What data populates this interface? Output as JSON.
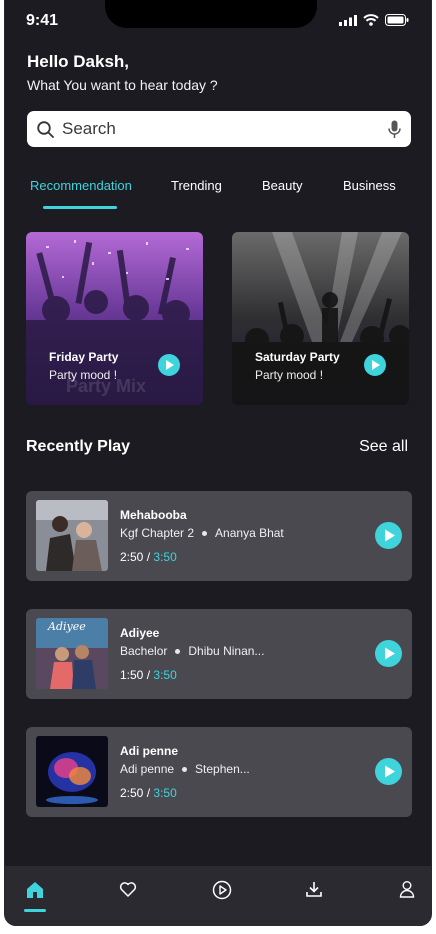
{
  "statusbar": {
    "time": "9:41"
  },
  "header": {
    "greeting": "Hello Daksh,",
    "subtitle": "What You want to hear today ?"
  },
  "search": {
    "placeholder": "Search"
  },
  "tabs": [
    {
      "label": "Recommendation",
      "active": true
    },
    {
      "label": "Trending",
      "active": false
    },
    {
      "label": "Beauty",
      "active": false
    },
    {
      "label": "Business",
      "active": false
    }
  ],
  "featured": [
    {
      "title": "Friday Party",
      "subtitle": "Party mood !",
      "watermark": "Party Mix"
    },
    {
      "title": "Saturday Party",
      "subtitle": "Party mood !"
    }
  ],
  "recent": {
    "title": "Recently Play",
    "see_all": "See all",
    "songs": [
      {
        "title": "Mehabooba",
        "album": "Kgf Chapter 2",
        "artist": "Ananya Bhat",
        "elapsed": "2:50",
        "separator": "/",
        "total": "3:50"
      },
      {
        "title": "Adiyee",
        "album": "Bachelor",
        "artist": "Dhibu Ninan...",
        "elapsed": "1:50",
        "separator": "/",
        "total": "3:50",
        "art_text": "Adiyee"
      },
      {
        "title": "Adi penne",
        "album": "Adi penne",
        "artist": "Stephen...",
        "elapsed": "2:50",
        "separator": "/",
        "total": "3:50"
      }
    ]
  },
  "colors": {
    "accent": "#3fd3dc",
    "background": "#1c1b22",
    "card": "#4a494f",
    "nav": "#2b2a30"
  },
  "bottom_nav": [
    {
      "icon": "home-icon",
      "active": true
    },
    {
      "icon": "heart-icon",
      "active": false
    },
    {
      "icon": "play-circle-icon",
      "active": false
    },
    {
      "icon": "download-icon",
      "active": false
    },
    {
      "icon": "profile-icon",
      "active": false
    }
  ]
}
